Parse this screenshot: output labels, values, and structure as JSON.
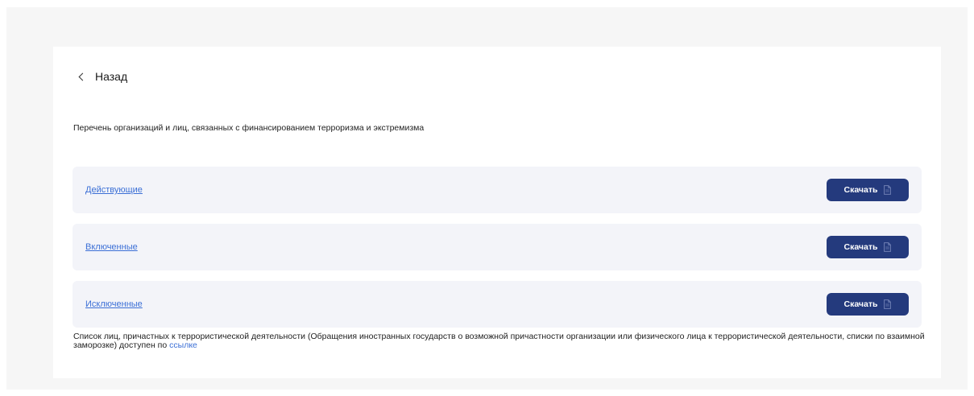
{
  "back": {
    "label": "Назад"
  },
  "heading": "Перечень организаций и лиц, связанных с финансированием терроризма и экстремизма",
  "rows": [
    {
      "label": "Действующие",
      "button": "Скачать"
    },
    {
      "label": "Включенные",
      "button": "Скачать"
    },
    {
      "label": "Исключенные",
      "button": "Скачать"
    }
  ],
  "footer": {
    "text": "Список лиц, причастных к террористической деятельности (Обращения иностранных государств о возможной причастности организации или физического лица к террористической деятельности, списки по взаимной заморозке) доступен по ",
    "link": "ссылке"
  },
  "colors": {
    "button_bg": "#243a7d",
    "link": "#3b6fd6",
    "row_bg": "#f3f4f9",
    "page_bg": "#f6f6f6"
  },
  "icons": {
    "back": "chevron-left-icon",
    "download": "document-icon"
  }
}
